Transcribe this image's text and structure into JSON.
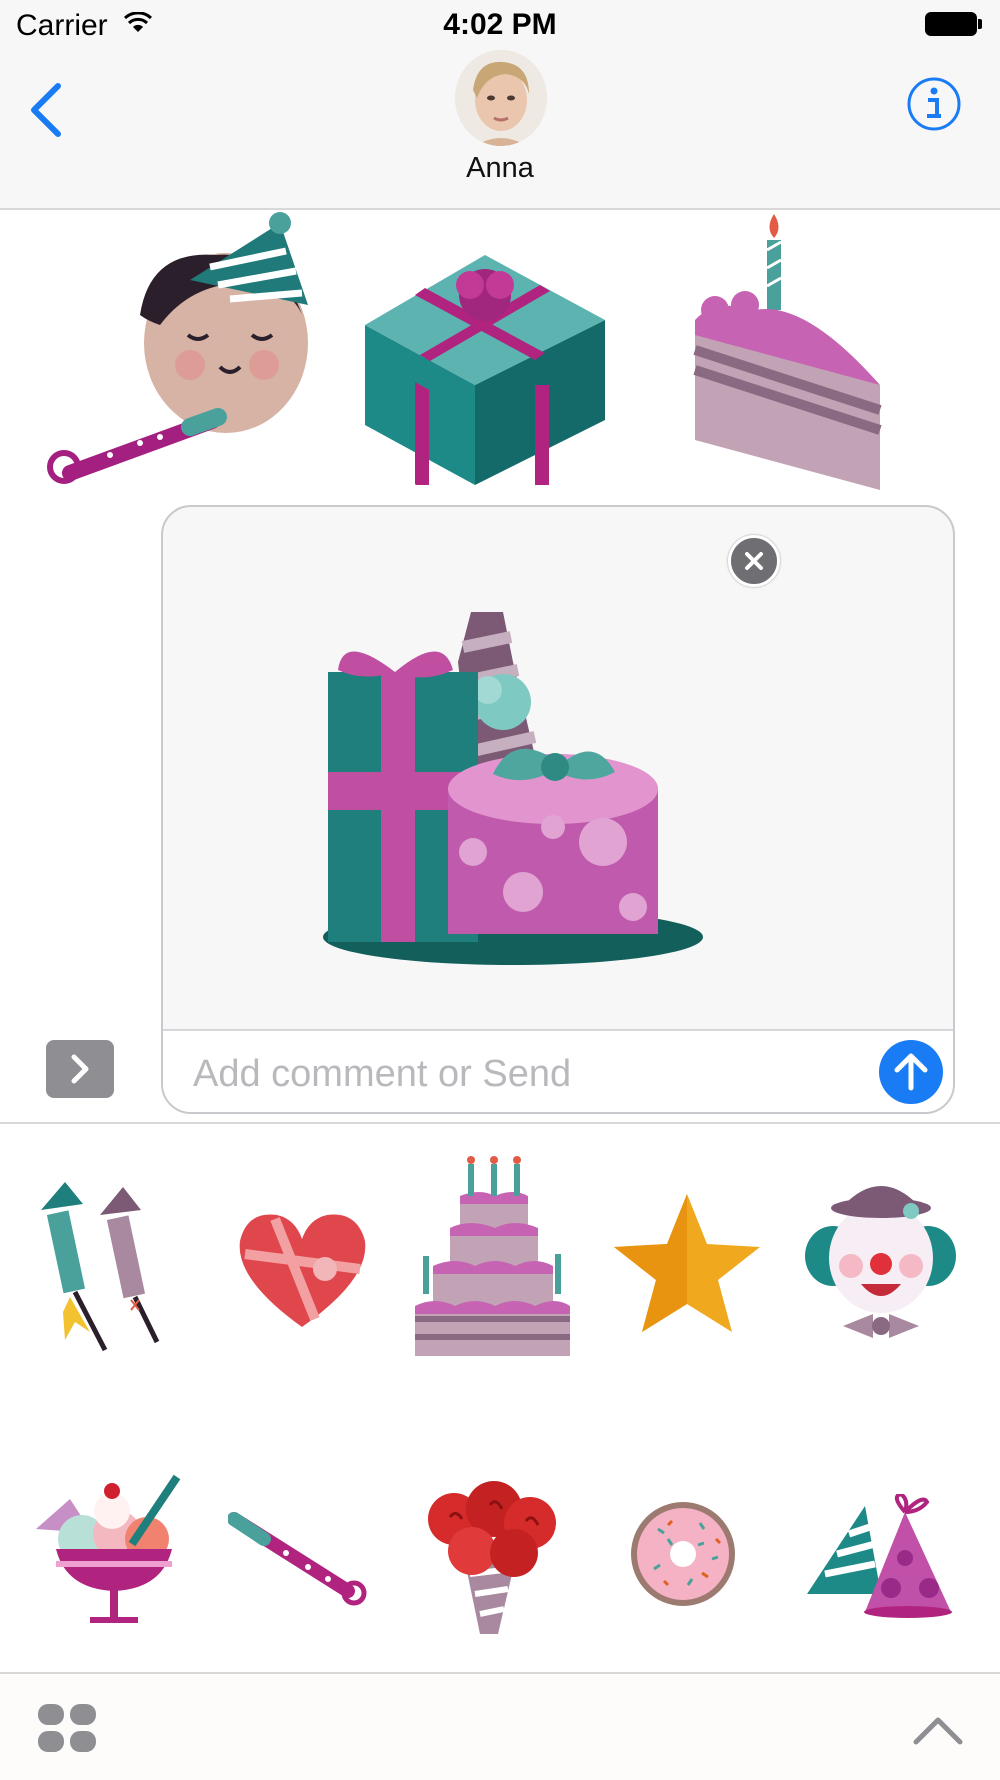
{
  "status_bar": {
    "carrier": "Carrier",
    "time": "4:02 PM"
  },
  "nav": {
    "contact_name": "Anna",
    "back_icon": "chevron-left-icon",
    "info_icon": "info-icon"
  },
  "conversation": {
    "stickers": [
      "party-boy-sticker",
      "gift-box-sticker",
      "cake-slice-sticker"
    ]
  },
  "compose": {
    "preview_sticker": "gifts-and-champagne-sticker",
    "placeholder": "Add comment or Send"
  },
  "sticker_tray": {
    "rows": [
      [
        "fireworks-rockets",
        "heart-candy-box",
        "birthday-cake",
        "gold-star",
        "clown-face"
      ],
      [
        "ice-cream-sundae",
        "party-horn",
        "rose-bouquet",
        "sprinkle-donut",
        "party-hats"
      ]
    ]
  },
  "colors": {
    "accent": "#1a7cf5",
    "teal": "#1e8a87",
    "magenta": "#c157a9",
    "mauve": "#a8899f"
  }
}
